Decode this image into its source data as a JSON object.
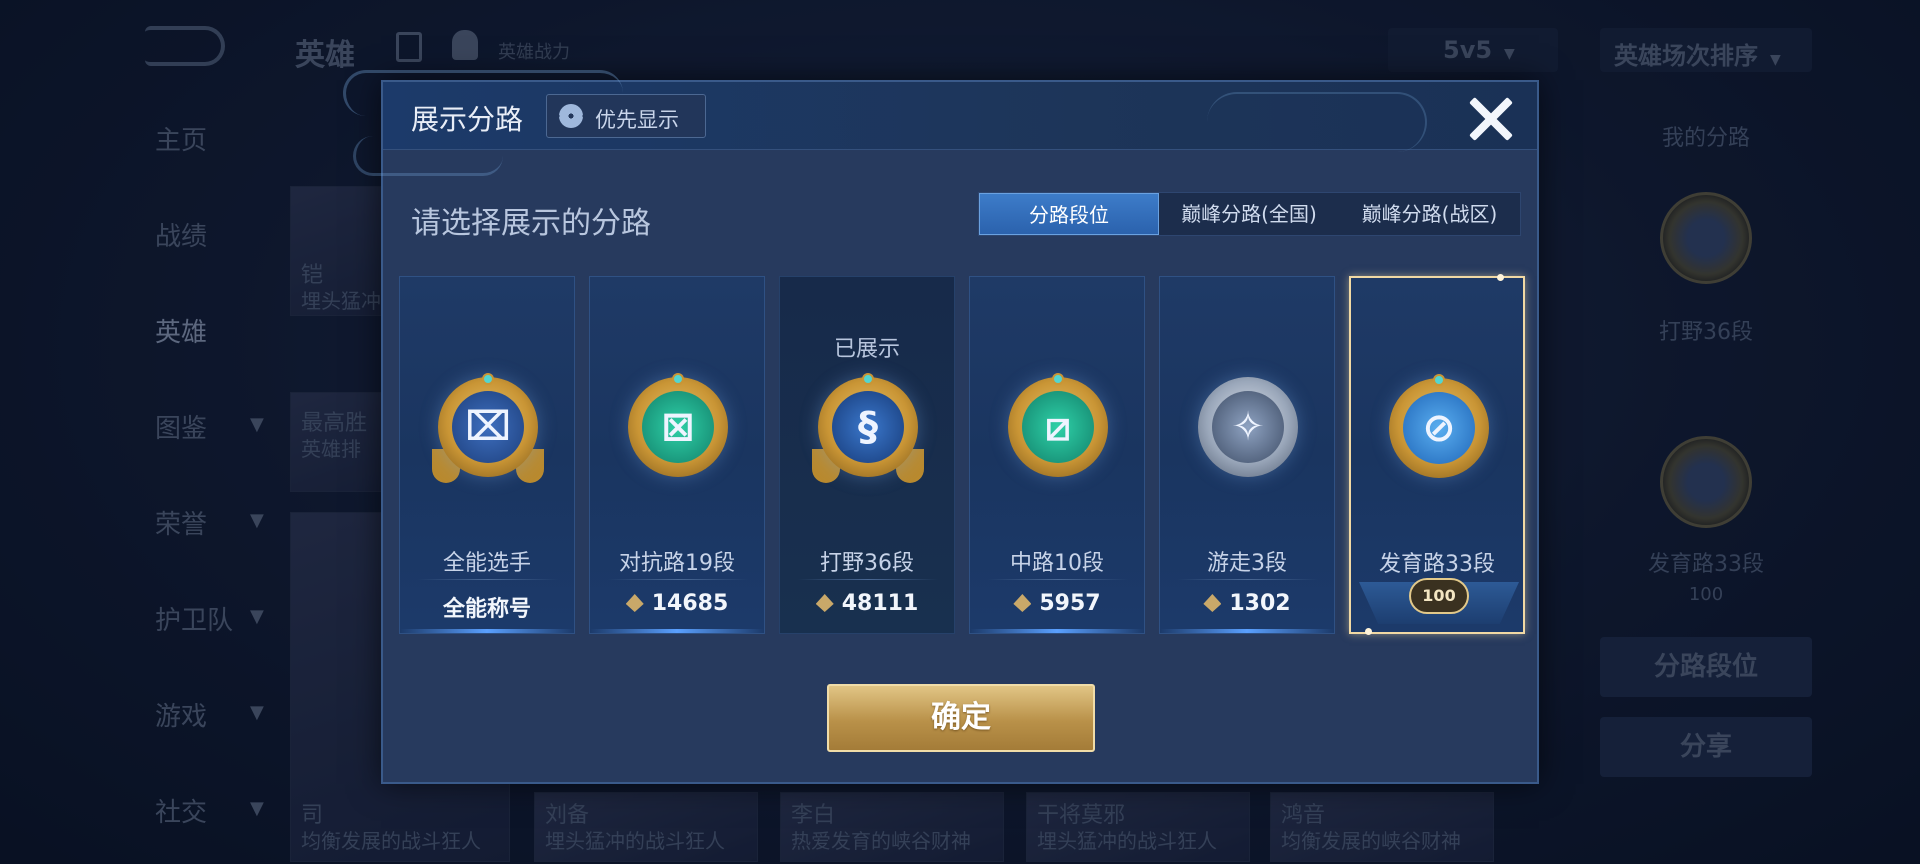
{
  "background": {
    "title": "英雄",
    "power_label": "英雄战力",
    "mode_select": "5v5",
    "sort_select": "英雄场次排序",
    "nav": [
      "主页",
      "战绩",
      "英雄",
      "图鉴",
      "荣誉",
      "护卫队",
      "游戏",
      "社交"
    ],
    "hero_cards": [
      {
        "name": "铠",
        "desc": "埋头猛冲"
      },
      {
        "name": "最高胜",
        "desc": "英雄排"
      },
      {
        "name": "司",
        "desc": "均衡发展的战斗狂人"
      },
      {
        "name": "刘备",
        "desc": "埋头猛冲的战斗狂人"
      },
      {
        "name": "李白",
        "desc": "热爱发育的峡谷财神"
      },
      {
        "name": "干将莫邪",
        "desc": "埋头猛冲的战斗狂人"
      },
      {
        "name": "鸿音",
        "desc": "均衡发展的峡谷财神"
      }
    ],
    "right_panel": {
      "title": "我的分路",
      "lane1": "打野36段",
      "lane2": "发育路33段",
      "rank_badge": "100",
      "button1": "分路段位",
      "button2": "分享"
    }
  },
  "modal": {
    "title": "展示分路",
    "priority_button": "优先显示",
    "prompt": "请选择展示的分路",
    "tabs": [
      "分路段位",
      "巅峰分路(全国)",
      "巅峰分路(战区)"
    ],
    "selected_tab": 0,
    "shown_label": "已展示",
    "lanes": [
      {
        "name": "全能选手",
        "score": "全能称号",
        "has_diamond": false,
        "state": "normal",
        "icon": "all-round-icon"
      },
      {
        "name": "对抗路19段",
        "score": "14685",
        "has_diamond": true,
        "state": "normal",
        "icon": "clash-lane-icon"
      },
      {
        "name": "打野36段",
        "score": "48111",
        "has_diamond": true,
        "state": "shown",
        "icon": "jungle-dragon-icon"
      },
      {
        "name": "中路10段",
        "score": "5957",
        "has_diamond": true,
        "state": "normal",
        "icon": "mid-lane-icon"
      },
      {
        "name": "游走3段",
        "score": "1302",
        "has_diamond": true,
        "state": "normal",
        "icon": "roam-wings-icon"
      },
      {
        "name": "发育路33段",
        "score": "",
        "has_diamond": false,
        "state": "selected",
        "icon": "farm-lane-icon",
        "rank_badge": "100"
      }
    ],
    "confirm": "确定"
  },
  "colors": {
    "accent_gold": "#c99535",
    "tab_blue": "#2b62ad",
    "modal_bg": "#273a5e"
  }
}
